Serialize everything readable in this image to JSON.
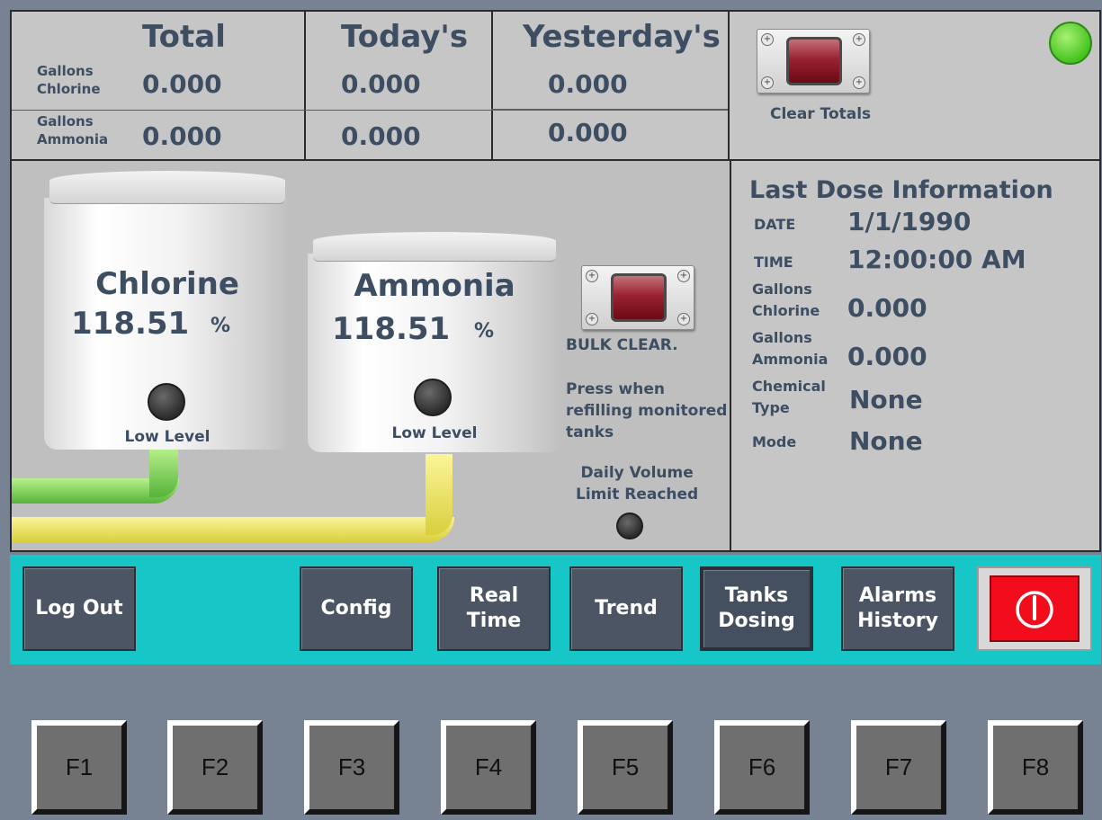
{
  "totals": {
    "headers": [
      "Total",
      "Today's",
      "Yesterday's"
    ],
    "rows": [
      {
        "label": "Gallons Chlorine",
        "label_l1": "Gallons",
        "label_l2": "Chlorine",
        "values": [
          "0.000",
          "0.000",
          "0.000"
        ]
      },
      {
        "label": "Gallons Ammonia",
        "label_l1": "Gallons",
        "label_l2": "Ammonia",
        "values": [
          "0.000",
          "0.000",
          "0.000"
        ]
      }
    ]
  },
  "clear_totals": {
    "label": "Clear Totals"
  },
  "status_led": {
    "color": "#45c41f"
  },
  "tanks": [
    {
      "name": "Chlorine",
      "level": "118.51",
      "unit": "%",
      "low_level_label": "Low Level"
    },
    {
      "name": "Ammonia",
      "level": "118.51",
      "unit": "%",
      "low_level_label": "Low Level"
    }
  ],
  "bulk_clear": {
    "label": "BULK CLEAR.",
    "note_l1": "Press when",
    "note_l2": "refilling monitored",
    "note_l3": "tanks",
    "daily_l1": "Daily Volume",
    "daily_l2": "Limit Reached"
  },
  "last_dose": {
    "title": "Last Dose Information",
    "date_label": "DATE",
    "date": "1/1/1990",
    "time_label": "TIME",
    "time": "12:00:00 AM",
    "chlorine_l1": "Gallons",
    "chlorine_l2": "Chlorine",
    "chlorine": "0.000",
    "ammonia_l1": "Gallons",
    "ammonia_l2": "Ammonia",
    "ammonia": "0.000",
    "type_l1": "Chemical",
    "type_l2": "Type",
    "type": "None",
    "mode_label": "Mode",
    "mode": "None"
  },
  "nav": {
    "logout": "Log Out",
    "config": "Config",
    "realtime_l1": "Real",
    "realtime_l2": "Time",
    "trend": "Trend",
    "tanks_l1": "Tanks",
    "tanks_l2": "Dosing",
    "alarms_l1": "Alarms",
    "alarms_l2": "History"
  },
  "fkeys": [
    "F1",
    "F2",
    "F3",
    "F4",
    "F5",
    "F6",
    "F7",
    "F8"
  ],
  "colors": {
    "nav_bar": "#17c6c6",
    "power_button": "#f20c1c",
    "pipe_chlorine": "#55b33a",
    "pipe_ammonia": "#d9cf3c"
  }
}
